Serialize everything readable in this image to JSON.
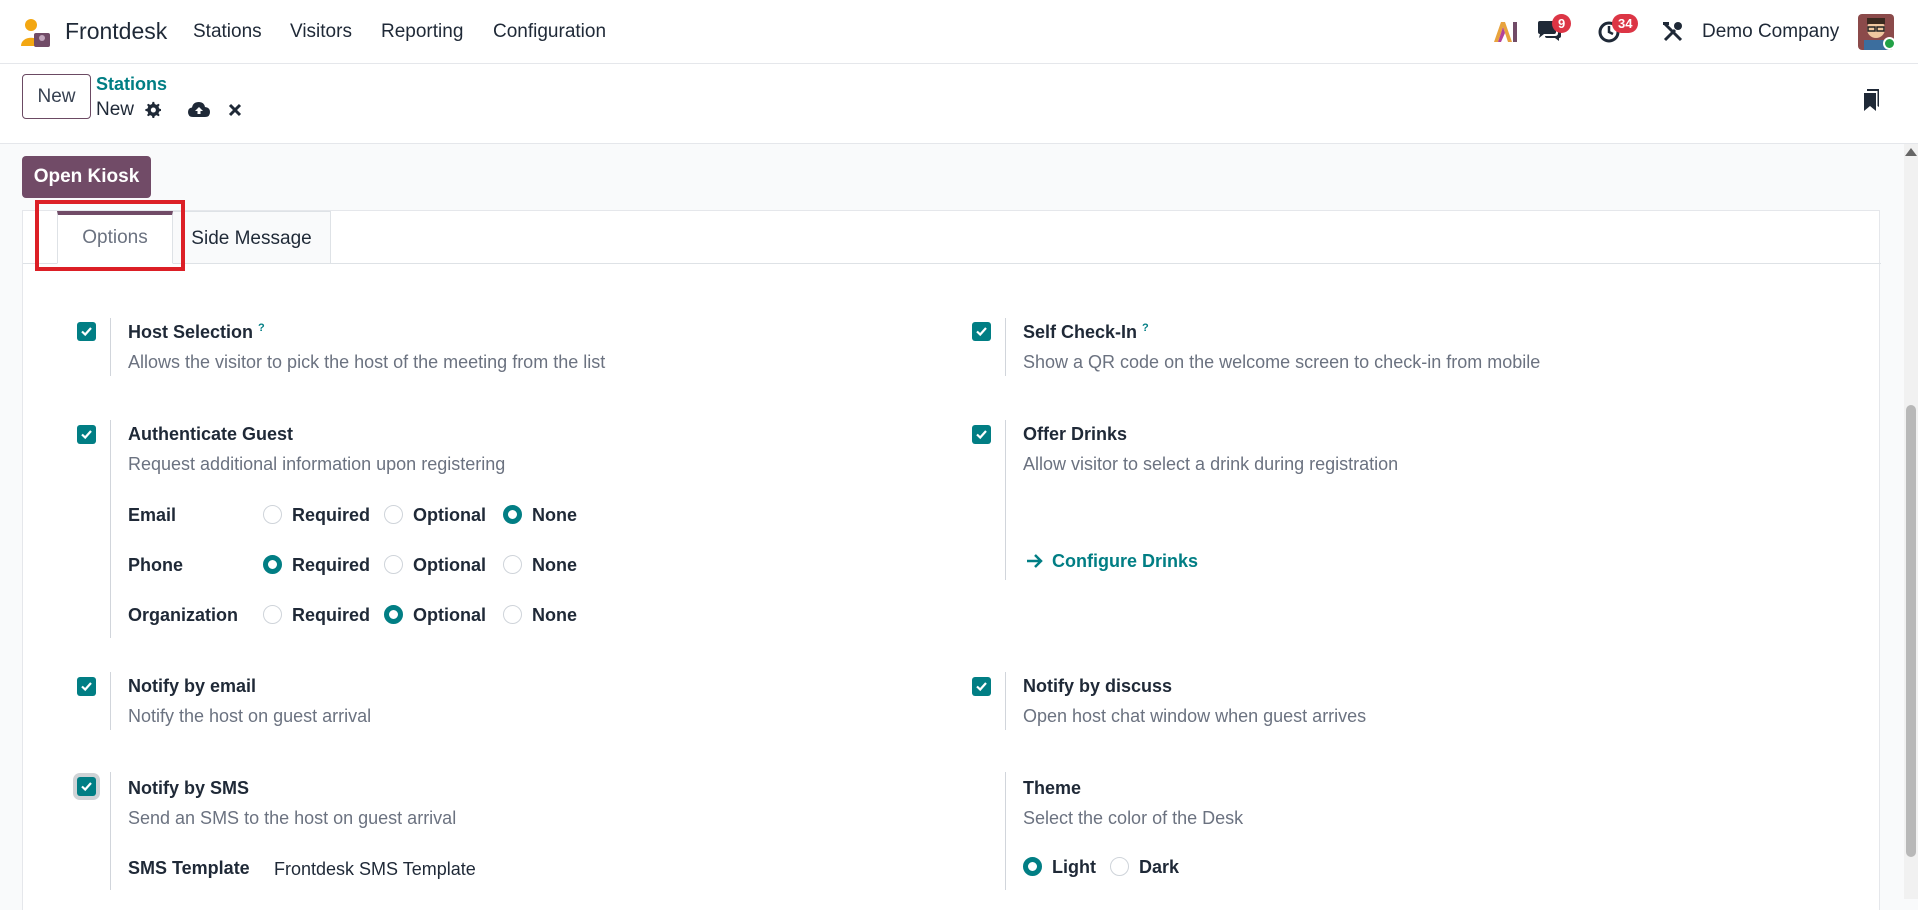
{
  "navbar": {
    "app_name": "Frontdesk",
    "menus": [
      "Stations",
      "Visitors",
      "Reporting",
      "Configuration"
    ],
    "messages_badge": "9",
    "activities_badge": "34",
    "company": "Demo Company"
  },
  "control": {
    "new_button": "New",
    "breadcrumb_parent": "Stations",
    "breadcrumb_current": "New"
  },
  "kiosk_button": "Open Kiosk",
  "tabs": [
    "Options",
    "Side Message"
  ],
  "settings": {
    "host_selection": {
      "title": "Host Selection",
      "help": "?",
      "desc": "Allows the visitor to pick the host of the meeting from the list",
      "checked": true
    },
    "self_checkin": {
      "title": "Self Check-In",
      "help": "?",
      "desc": "Show a QR code on the welcome screen to check-in from mobile",
      "checked": true
    },
    "authenticate_guest": {
      "title": "Authenticate Guest",
      "desc": "Request additional information upon registering",
      "checked": true
    },
    "offer_drinks": {
      "title": "Offer Drinks",
      "desc": "Allow visitor to select a drink during registration",
      "checked": true,
      "link": "Configure Drinks"
    },
    "notify_email": {
      "title": "Notify by email",
      "desc": "Notify the host on guest arrival",
      "checked": true
    },
    "notify_discuss": {
      "title": "Notify by discuss",
      "desc": "Open host chat window when guest arrives",
      "checked": true
    },
    "notify_sms": {
      "title": "Notify by SMS",
      "desc": "Send an SMS to the host on guest arrival",
      "checked": true
    },
    "theme": {
      "title": "Theme",
      "desc": "Select the color of the Desk",
      "options": [
        "Light",
        "Dark"
      ],
      "selected": "Light"
    }
  },
  "auth_fields": {
    "options": [
      "Required",
      "Optional",
      "None"
    ],
    "rows": [
      {
        "label": "Email",
        "selected": "None"
      },
      {
        "label": "Phone",
        "selected": "Required"
      },
      {
        "label": "Organization",
        "selected": "Optional"
      }
    ]
  },
  "sms_template": {
    "label": "SMS Template",
    "value": "Frontdesk SMS Template"
  },
  "colors": {
    "brand": "#714b67",
    "accent": "#017e84",
    "badge": "#dc3545",
    "highlight": "#dc1f26"
  }
}
